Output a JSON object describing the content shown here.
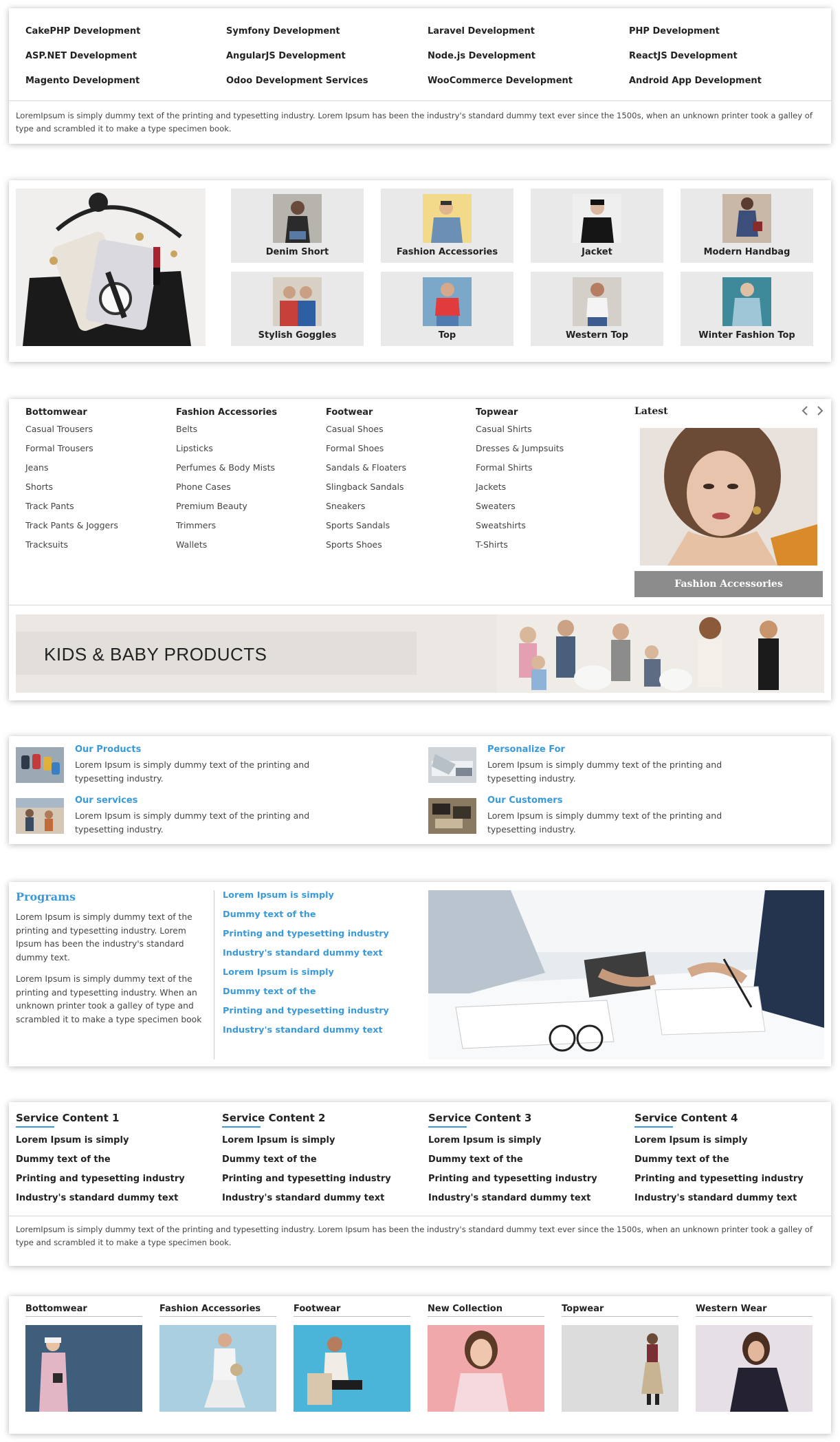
{
  "services_links": {
    "items": [
      "CakePHP Development",
      "Symfony Development",
      "Laravel Development",
      "PHP Development",
      "ASP.NET Development",
      "AngularJS Development",
      "Node.js Development",
      "ReactJS Development",
      "Magento Development",
      "Odoo Development Services",
      "WooCommerce Development",
      "Android App Development"
    ],
    "description": "LoremIpsum is simply dummy text of the printing and typesetting industry. Lorem Ipsum has been the industry's standard dummy text ever since the 1500s, when an unknown printer took a galley of type and scrambled it to make a type specimen book."
  },
  "fashion_categories": {
    "items": [
      "Denim Short",
      "Fashion Accessories",
      "Jacket",
      "Modern Handbag",
      "Stylish Goggles",
      "Top",
      "Western Top",
      "Winter Fashion Top"
    ]
  },
  "mega_menu": {
    "columns": [
      {
        "heading": "Bottomwear",
        "items": [
          "Casual Trousers",
          "Formal Trousers",
          "Jeans",
          "Shorts",
          "Track Pants",
          "Track Pants & Joggers",
          "Tracksuits"
        ]
      },
      {
        "heading": "Fashion Accessories",
        "items": [
          "Belts",
          "Lipsticks",
          "Perfumes & Body Mists",
          "Phone Cases",
          "Premium Beauty",
          "Trimmers",
          "Wallets"
        ]
      },
      {
        "heading": "Footwear",
        "items": [
          "Casual Shoes",
          "Formal Shoes",
          "Sandals & Floaters",
          "Slingback Sandals",
          "Sneakers",
          "Sports Sandals",
          "Sports Shoes"
        ]
      },
      {
        "heading": "Topwear",
        "items": [
          "Casual Shirts",
          "Dresses & Jumpsuits",
          "Formal Shirts",
          "Jackets",
          "Sweaters",
          "Sweatshirts",
          "T-Shirts"
        ]
      }
    ],
    "latest_title": "Latest",
    "latest_button": "Fashion Accessories",
    "banner_title": "KIDS & BABY PRODUCTS",
    "prev_icon": "chevron-left-icon",
    "next_icon": "chevron-right-icon"
  },
  "features": {
    "items": [
      {
        "title": "Our Products",
        "text": "Lorem Ipsum is simply dummy text of the printing and typesetting industry."
      },
      {
        "title": "Personalize For",
        "text": "Lorem Ipsum is simply dummy text of the printing and typesetting industry."
      },
      {
        "title": "Our services",
        "text": "Lorem Ipsum is simply dummy text of the printing and typesetting industry."
      },
      {
        "title": "Our Customers",
        "text": "Lorem Ipsum is simply dummy text of the printing and typesetting industry."
      }
    ]
  },
  "programs": {
    "title": "Programs",
    "para1": "Lorem Ipsum is simply dummy text of the printing and typesetting industry. Lorem Ipsum has been the industry's standard dummy text.",
    "para2": "Lorem Ipsum is simply dummy text of the printing and typesetting industry. When an unknown printer took a galley of type and scrambled it to make a type specimen book",
    "links": [
      "Lorem Ipsum is simply",
      "Dummy text of the",
      "Printing and typesetting industry",
      "Industry's standard dummy text",
      "Lorem Ipsum is simply",
      "Dummy text of the",
      "Printing and typesetting industry",
      "Industry's standard dummy text"
    ]
  },
  "service_content": {
    "columns": [
      {
        "title": "Service Content 1",
        "items": [
          "Lorem Ipsum is simply",
          "Dummy text of the",
          "Printing and typesetting industry",
          "Industry's standard dummy text"
        ]
      },
      {
        "title": "Service Content 2",
        "items": [
          "Lorem Ipsum is simply",
          "Dummy text of the",
          "Printing and typesetting industry",
          "Industry's standard dummy text"
        ]
      },
      {
        "title": "Service Content 3",
        "items": [
          "Lorem Ipsum is simply",
          "Dummy text of the",
          "Printing and typesetting industry",
          "Industry's standard dummy text"
        ]
      },
      {
        "title": "Service Content 4",
        "items": [
          "Lorem Ipsum is simply",
          "Dummy text of the",
          "Printing and typesetting industry",
          "Industry's standard dummy text"
        ]
      }
    ],
    "description": "LoremIpsum is simply dummy text of the printing and typesetting industry. Lorem Ipsum has been the industry's standard dummy text ever since the 1500s, when an unknown printer took a galley of type and scrambled it to make a type specimen book."
  },
  "gallery": {
    "items": [
      "Bottomwear",
      "Fashion Accessories",
      "Footwear",
      "New Collection",
      "Topwear",
      "Western Wear"
    ]
  }
}
